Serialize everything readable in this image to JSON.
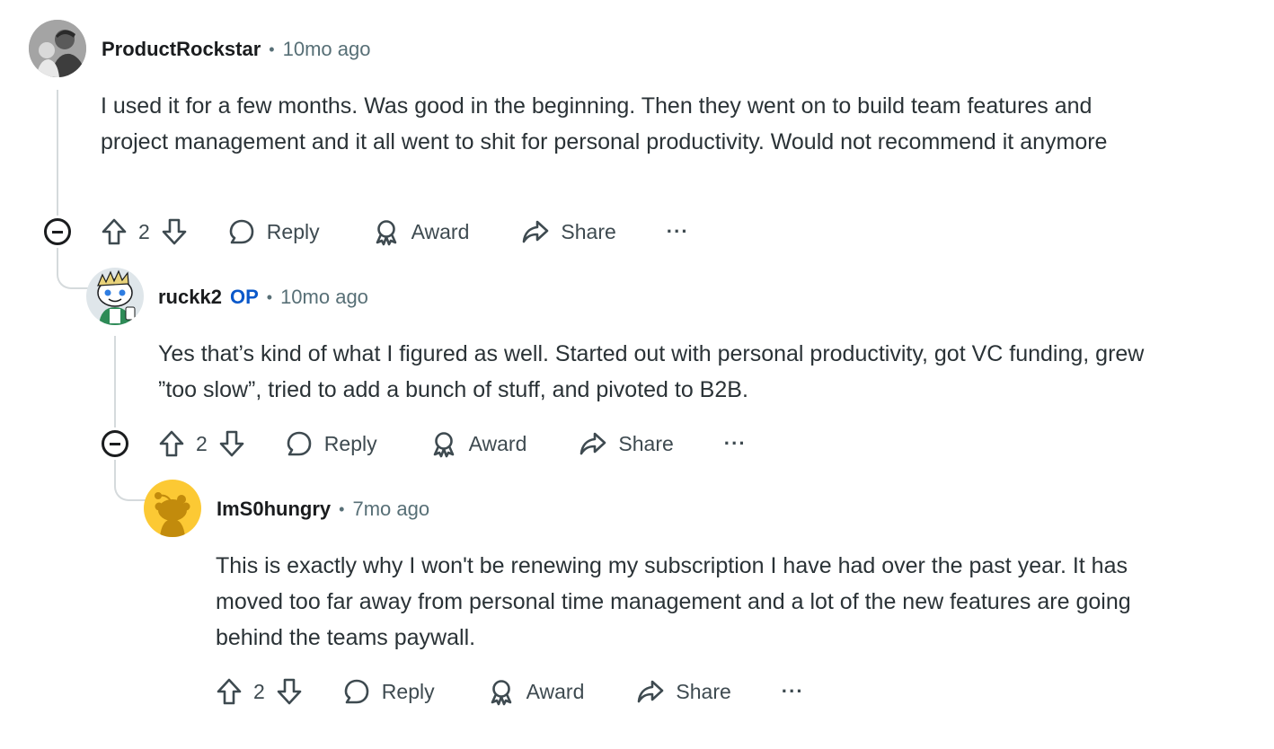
{
  "comments": [
    {
      "username": "ProductRockstar",
      "op_badge": "",
      "time": "10mo ago",
      "body": "I used it for a few months. Was good in the beginning. Then they went on to build team features and project management and it all went to shit for personal productivity. Would not recommend it anymore",
      "votes": "2",
      "reply_label": "Reply",
      "award_label": "Award",
      "share_label": "Share",
      "more_label": "···",
      "avatar_icon": "photo-avatar-icon"
    },
    {
      "username": "ruckk2",
      "op_badge": "OP",
      "time": "10mo ago",
      "body": "Yes that’s kind of what I figured as well. Started out with personal productivity, got VC funding, grew ”too slow”, tried to add a bunch of stuff, and pivoted to B2B.",
      "votes": "2",
      "reply_label": "Reply",
      "award_label": "Award",
      "share_label": "Share",
      "more_label": "···",
      "avatar_icon": "snoo-avatar-icon"
    },
    {
      "username": "ImS0hungry",
      "op_badge": "",
      "time": "7mo ago",
      "body": "This is exactly why I won't be renewing my subscription I have had over the past year. It has moved too far away from personal time management and a lot of the new features are going behind the teams paywall.",
      "votes": "2",
      "reply_label": "Reply",
      "award_label": "Award",
      "share_label": "Share",
      "more_label": "···",
      "avatar_icon": "default-snoo-avatar-icon"
    }
  ],
  "separator": "•",
  "colors": {
    "op_badge": "#0a58ca",
    "meta_text": "#576f76",
    "thread_line": "#d5dadc",
    "default_avatar_bg": "#fcc934"
  }
}
